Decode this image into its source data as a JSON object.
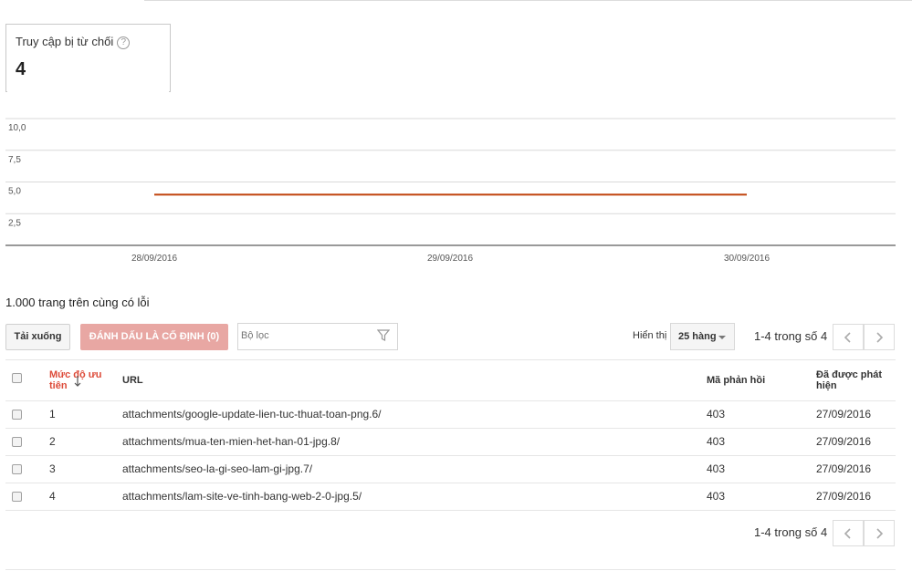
{
  "metric": {
    "title": "Truy cập bị từ chối",
    "value": "4",
    "help_icon": "?"
  },
  "chart_data": {
    "type": "line",
    "y_ticks": [
      "10,0",
      "7,5",
      "5,0",
      "2,5"
    ],
    "x_ticks": [
      "28/09/2016",
      "29/09/2016",
      "30/09/2016"
    ],
    "x": [
      "28/09/2016",
      "29/09/2016",
      "30/09/2016"
    ],
    "series": [
      {
        "values": [
          4,
          4,
          4
        ],
        "color": "#c1440e"
      }
    ],
    "ylim": [
      0,
      10
    ],
    "grid": true
  },
  "section_title": "1.000 trang trên cùng có lỗi",
  "toolbar": {
    "download_label": "Tải xuống",
    "mark_fixed_label": "ĐÁNH DẤU LÀ CỐ ĐỊNH (0)",
    "filter_placeholder": "Bộ lọc",
    "show_label": "Hiển thị",
    "rows_value": "25 hàng",
    "page_info": "1-4 trong số 4"
  },
  "table": {
    "headers": {
      "priority_line1": "Mức độ ưu",
      "priority_line2": "tiên",
      "url": "URL",
      "response_code": "Mã phản hồi",
      "detected_line1": "Đã được phát",
      "detected_line2": "hiện"
    },
    "rows": [
      {
        "priority": "1",
        "url": "attachments/google-update-lien-tuc-thuat-toan-png.6/",
        "code": "403",
        "date": "27/09/2016"
      },
      {
        "priority": "2",
        "url": "attachments/mua-ten-mien-het-han-01-jpg.8/",
        "code": "403",
        "date": "27/09/2016"
      },
      {
        "priority": "3",
        "url": "attachments/seo-la-gi-seo-lam-gi-jpg.7/",
        "code": "403",
        "date": "27/09/2016"
      },
      {
        "priority": "4",
        "url": "attachments/lam-site-ve-tinh-bang-web-2-0-jpg.5/",
        "code": "403",
        "date": "27/09/2016"
      }
    ]
  },
  "footer": {
    "page_info": "1-4 trong số 4"
  }
}
